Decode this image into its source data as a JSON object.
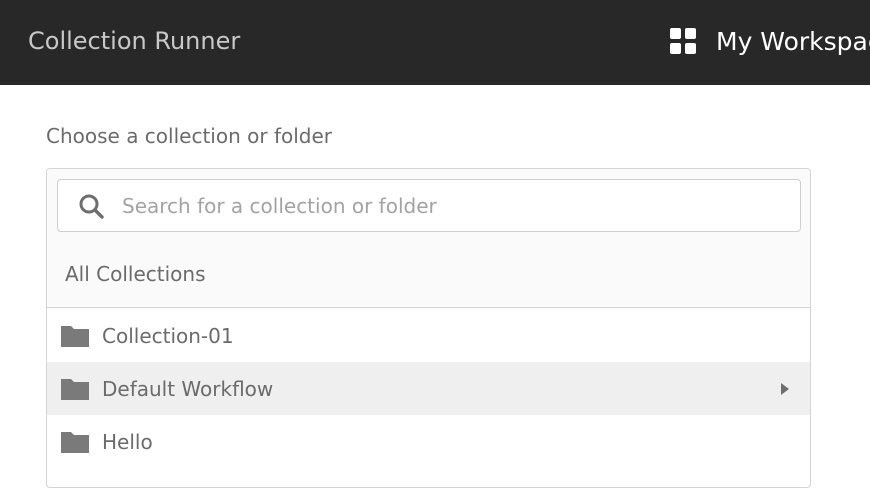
{
  "header": {
    "title": "Collection Runner",
    "workspace_label": "My Workspace",
    "workspace_icon": "grid-icon"
  },
  "section": {
    "label": "Choose a collection or folder"
  },
  "search": {
    "placeholder": "Search for a collection or folder",
    "value": "",
    "icon": "search-icon"
  },
  "breadcrumb": {
    "label": "All Collections"
  },
  "collections": [
    {
      "label": "Collection-01",
      "icon": "folder-icon",
      "highlighted": false,
      "has_children": false
    },
    {
      "label": "Default Workflow",
      "icon": "folder-icon",
      "highlighted": true,
      "has_children": true
    },
    {
      "label": "Hello",
      "icon": "folder-icon",
      "highlighted": false,
      "has_children": false
    }
  ],
  "colors": {
    "header_bg": "#282828",
    "highlight_bg": "#efefef",
    "icon_gray": "#7a7a7a"
  }
}
